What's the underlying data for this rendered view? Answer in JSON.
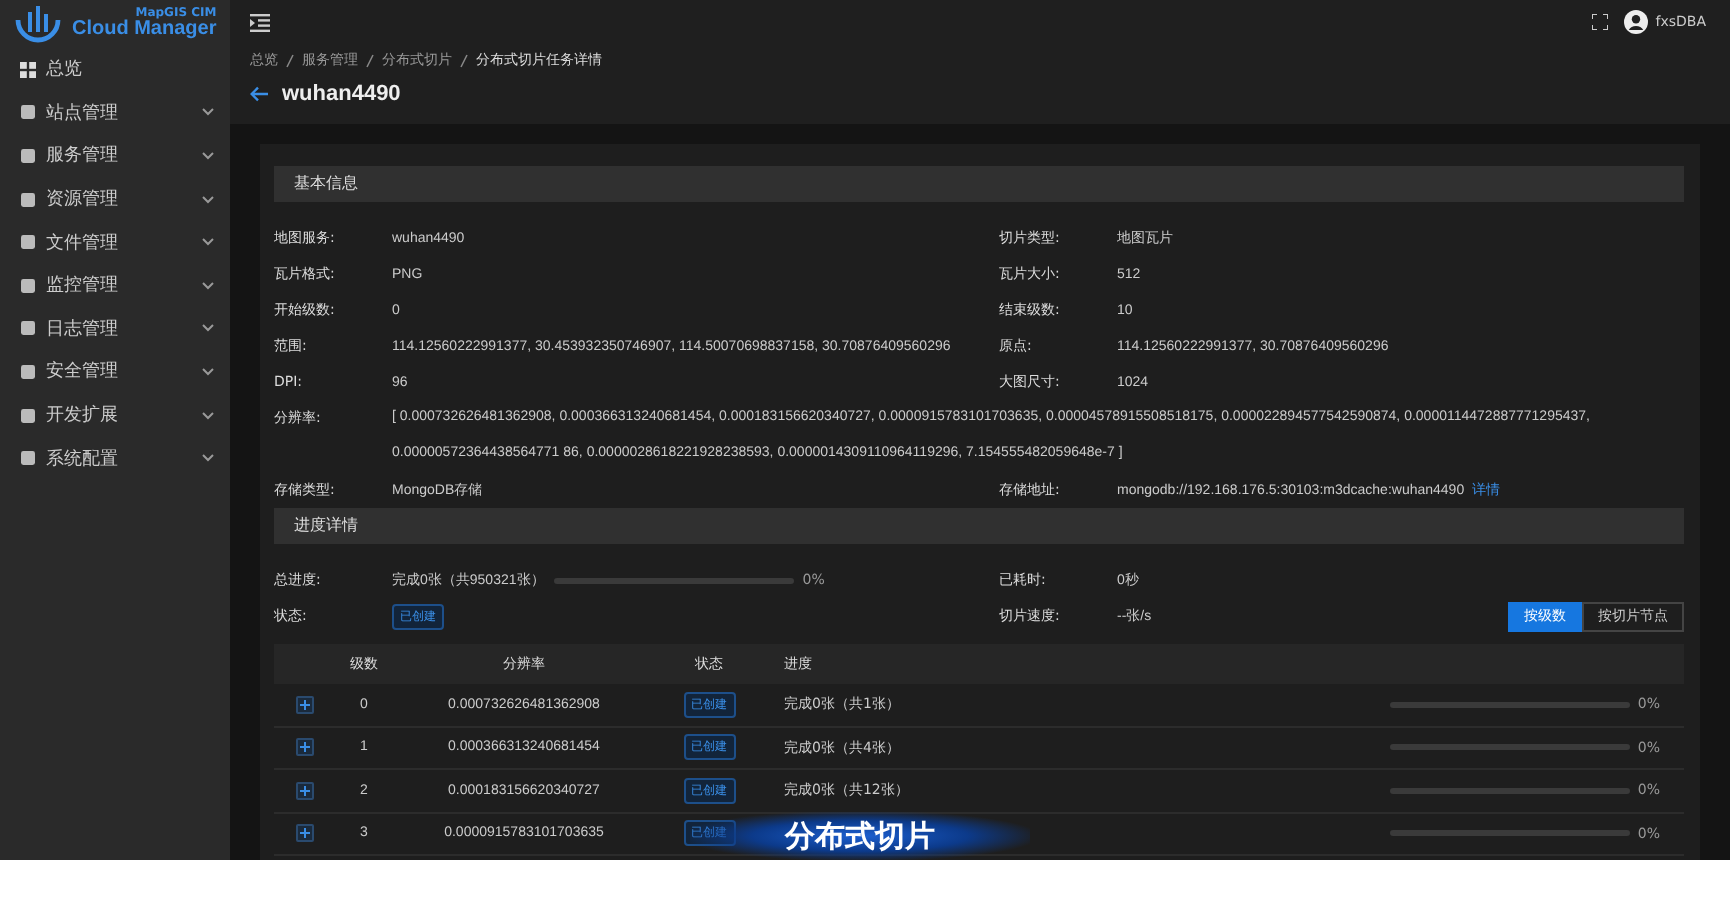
{
  "logo": {
    "top": "MapGIS CIM",
    "bottom": "Cloud Manager"
  },
  "sidebar": {
    "items": [
      {
        "label": "总览"
      },
      {
        "label": "站点管理",
        "expanded": false
      },
      {
        "label": "服务管理",
        "expanded": false
      },
      {
        "label": "资源管理",
        "expanded": false
      },
      {
        "label": "文件管理",
        "expanded": false
      },
      {
        "label": "监控管理",
        "expanded": false
      },
      {
        "label": "日志管理",
        "expanded": false
      },
      {
        "label": "安全管理",
        "expanded": false
      },
      {
        "label": "开发扩展",
        "expanded": false
      },
      {
        "label": "系统配置",
        "expanded": false
      }
    ]
  },
  "header": {
    "user": "fxsDBA"
  },
  "breadcrumb": [
    "总览",
    "服务管理",
    "分布式切片",
    "分布式切片任务详情"
  ],
  "page_title": "wuhan4490",
  "basic_info": {
    "title": "基本信息",
    "fields": [
      {
        "label": "地图服务:",
        "value": "wuhan4490"
      },
      {
        "label": "切片类型:",
        "value": "地图瓦片"
      },
      {
        "label": "瓦片格式:",
        "value": "PNG"
      },
      {
        "label": "瓦片大小:",
        "value": "512"
      },
      {
        "label": "开始级数:",
        "value": "0"
      },
      {
        "label": "结束级数:",
        "value": "10"
      },
      {
        "label": "范围:",
        "value": "114.12560222991377, 30.453932350746907, 114.50070698837158, 30.70876409560296"
      },
      {
        "label": "原点:",
        "value": "114.12560222991377, 30.70876409560296"
      },
      {
        "label": "DPI:",
        "value": "96"
      },
      {
        "label": "大图尺寸:",
        "value": "1024"
      },
      {
        "label": "分辨率:",
        "value": "[ 0.000732626481362908, 0.000366313240681454, 0.000183156620340727, 0.0000915783101703635, 0.00004578915508518175, 0.000022894577542590874, 0.0000114472887771295437, 0.00000572364438564771 86, 0.0000028618221928238593, 0.0000014309110964119296, 7.154555482059648e-7 ]",
        "kind": "wide"
      },
      {
        "label": "存储类型:",
        "value": "MongoDB存储"
      },
      {
        "label": "存储地址:",
        "value": "mongodb://192.168.176.5:30103:m3dcache:wuhan4490",
        "link": "详情"
      }
    ]
  },
  "progress": {
    "title": "进度详情",
    "total_label": "总进度:",
    "total_text": "完成0张（共950321张）",
    "level": 0,
    "percent": "0%",
    "elapsed_label": "已耗时:",
    "elapsed": "0秒",
    "status_label": "状态:",
    "status": "已创建",
    "speed_label": "切片速度:",
    "speed": "--张/s",
    "view_buttons": [
      {
        "label": "按级数",
        "selected": true
      },
      {
        "label": "按切片节点",
        "selected": false
      }
    ]
  },
  "table": {
    "columns": [
      "级数",
      "分辨率",
      "状态",
      "进度"
    ],
    "rows": [
      {
        "level_no": "0",
        "resolution": "0.000732626481362908",
        "status": "已创建",
        "progress": "完成0张（共1张）",
        "level": 0,
        "percent": "0%",
        "expanded": false
      },
      {
        "level_no": "1",
        "resolution": "0.000366313240681454",
        "status": "已创建",
        "progress": "完成0张（共4张）",
        "level": 0,
        "percent": "0%",
        "expanded": false
      },
      {
        "level_no": "2",
        "resolution": "0.000183156620340727",
        "status": "已创建",
        "progress": "完成0张（共12张）",
        "level": 0,
        "percent": "0%",
        "expanded": false
      },
      {
        "level_no": "3",
        "resolution": "0.0000915783101703635",
        "status": "已创建",
        "level": 0,
        "percent": "0%",
        "expanded": false
      }
    ]
  },
  "caption": "分布式切片"
}
